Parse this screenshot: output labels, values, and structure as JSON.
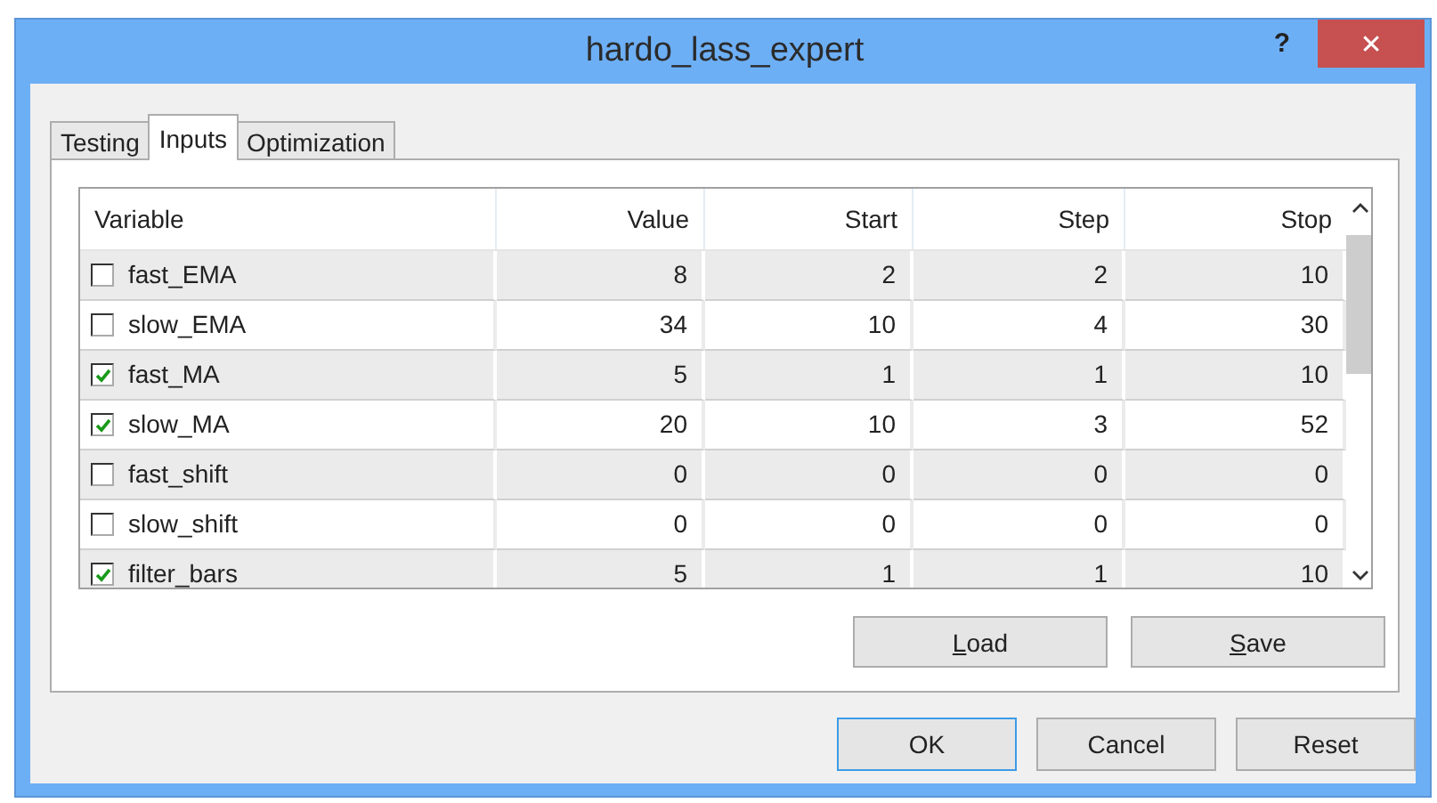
{
  "window": {
    "title": "hardo_lass_expert",
    "help": "?",
    "close": "✕"
  },
  "tabs": [
    {
      "label": "Testing",
      "selected": false
    },
    {
      "label": "Inputs",
      "selected": true
    },
    {
      "label": "Optimization",
      "selected": false
    }
  ],
  "table": {
    "columns": [
      "Variable",
      "Value",
      "Start",
      "Step",
      "Stop"
    ],
    "rows": [
      {
        "checked": false,
        "name": "fast_EMA",
        "value": "8",
        "start": "2",
        "step": "2",
        "stop": "10"
      },
      {
        "checked": false,
        "name": "slow_EMA",
        "value": "34",
        "start": "10",
        "step": "4",
        "stop": "30"
      },
      {
        "checked": true,
        "name": "fast_MA",
        "value": "5",
        "start": "1",
        "step": "1",
        "stop": "10"
      },
      {
        "checked": true,
        "name": "slow_MA",
        "value": "20",
        "start": "10",
        "step": "3",
        "stop": "52"
      },
      {
        "checked": false,
        "name": "fast_shift",
        "value": "0",
        "start": "0",
        "step": "0",
        "stop": "0"
      },
      {
        "checked": false,
        "name": "slow_shift",
        "value": "0",
        "start": "0",
        "step": "0",
        "stop": "0"
      },
      {
        "checked": true,
        "name": "filter_bars",
        "value": "5",
        "start": "1",
        "step": "1",
        "stop": "10"
      }
    ]
  },
  "panel_buttons": [
    {
      "label": "Load",
      "underline_first": true
    },
    {
      "label": "Save",
      "underline_first": true
    }
  ],
  "dialog_buttons": [
    {
      "label": "OK",
      "default": true
    },
    {
      "label": "Cancel",
      "default": false
    },
    {
      "label": "Reset",
      "default": false
    }
  ]
}
